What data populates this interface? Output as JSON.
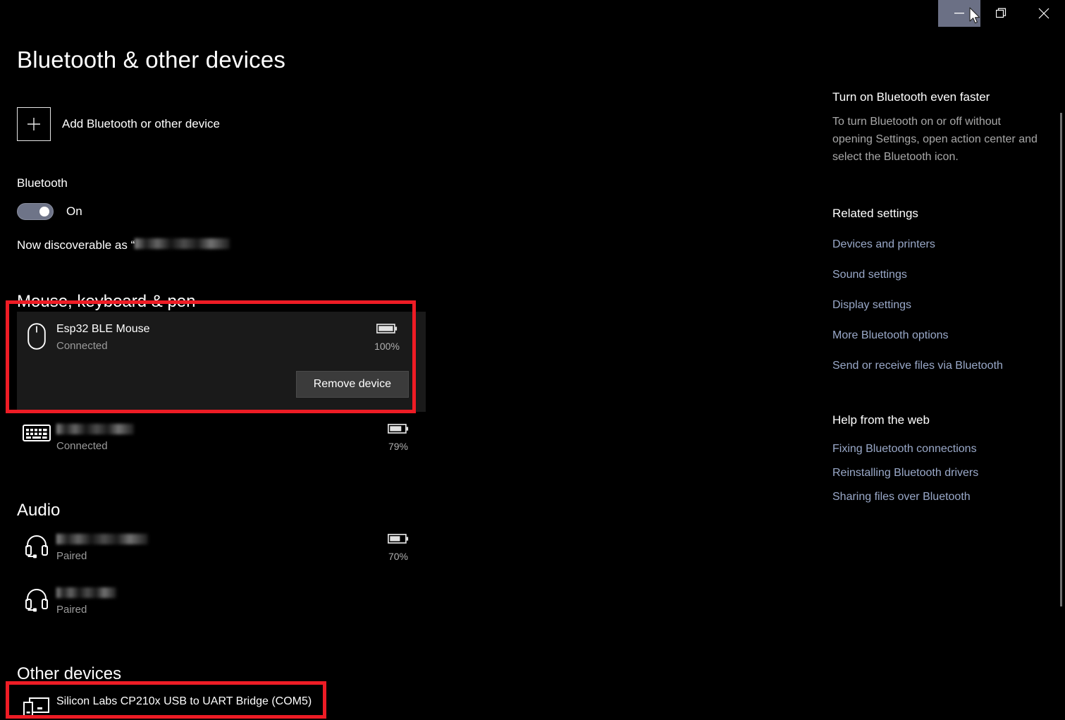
{
  "window": {
    "controls": [
      {
        "name": "minimize",
        "glyph": "minimize-icon",
        "hovered": true
      },
      {
        "name": "maximize",
        "glyph": "maximize-icon",
        "hovered": false
      },
      {
        "name": "close",
        "glyph": "close-icon",
        "hovered": false
      }
    ],
    "hover_color": "#6b7085"
  },
  "page": {
    "title": "Bluetooth & other devices"
  },
  "add_device": {
    "label": "Add Bluetooth or other device",
    "icon": "plus-icon"
  },
  "bluetooth": {
    "label": "Bluetooth",
    "toggle_state": "On",
    "toggle_on": true,
    "discoverable_prefix": "Now discoverable as “",
    "discoverable_name_redacted": true
  },
  "groups": [
    {
      "heading": "Mouse, keyboard & pen",
      "devices": [
        {
          "icon": "mouse-icon",
          "name": "Esp32 BLE Mouse",
          "redacted": false,
          "status": "Connected",
          "battery": "100%",
          "battery_fill": 100,
          "selected": true,
          "action_label": "Remove device"
        },
        {
          "icon": "keyboard-icon",
          "name": "",
          "redacted": true,
          "status": "Connected",
          "battery": "79%",
          "battery_fill": 79,
          "selected": false
        }
      ]
    },
    {
      "heading": "Audio",
      "devices": [
        {
          "icon": "headset-icon",
          "name": "",
          "redacted": true,
          "status": "Paired",
          "battery": "70%",
          "battery_fill": 70,
          "selected": false
        },
        {
          "icon": "headset-icon",
          "name": "",
          "redacted": true,
          "status": "Paired",
          "battery": "",
          "battery_fill": null,
          "selected": false
        }
      ]
    },
    {
      "heading": "Other devices",
      "devices": [
        {
          "icon": "devices-icon",
          "name": "Silicon Labs CP210x USB to UART Bridge (COM5)",
          "redacted": false,
          "status": "",
          "battery": "",
          "battery_fill": null,
          "selected": false
        }
      ]
    }
  ],
  "rail": {
    "tip_heading": "Turn on Bluetooth even faster",
    "tip_body": "To turn Bluetooth on or off without opening Settings, open action center and select the Bluetooth icon.",
    "related_heading": "Related settings",
    "related_links": [
      "Devices and printers",
      "Sound settings",
      "Display settings",
      "More Bluetooth options",
      "Send or receive files via Bluetooth"
    ],
    "help_heading": "Help from the web",
    "help_links": [
      "Fixing Bluetooth connections",
      "Reinstalling Bluetooth drivers",
      "Sharing files over Bluetooth"
    ],
    "link_color": "#9aa9c9"
  },
  "annotations": [
    {
      "name": "mouse-device-highlight",
      "color": "#ee1c25"
    },
    {
      "name": "other-device-highlight",
      "color": "#ee1c25"
    }
  ]
}
